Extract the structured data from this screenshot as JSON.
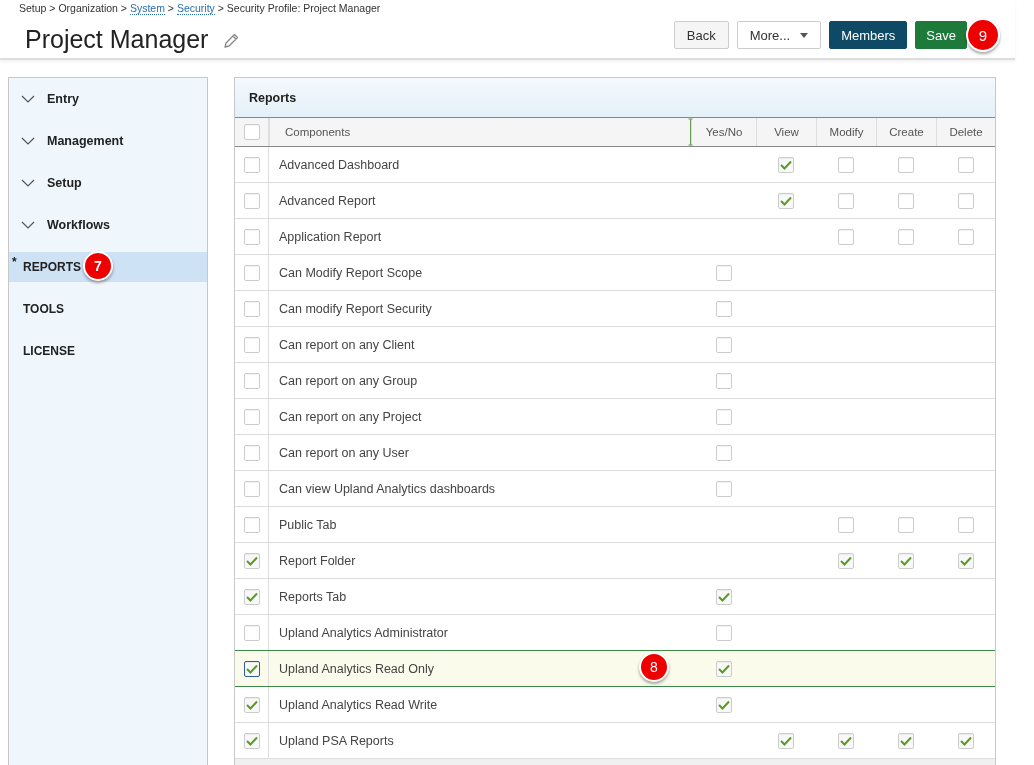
{
  "breadcrumb": [
    {
      "label": "Setup > Organization >",
      "link": false
    },
    {
      "label": "System",
      "link": true
    },
    {
      "label": ">",
      "link": false
    },
    {
      "label": "Security",
      "link": true
    },
    {
      "label": "> Security Profile: Project Manager",
      "link": false
    }
  ],
  "title": "Project Manager",
  "buttons": [
    {
      "label": "Back",
      "kind": "plain"
    },
    {
      "label": "More...",
      "kind": "dropdown"
    },
    {
      "label": "Members",
      "kind": "dark"
    },
    {
      "label": "Save",
      "kind": "primary",
      "badge": "9"
    }
  ],
  "sidebar": {
    "items": [
      {
        "label": "Entry",
        "kind": "group",
        "expanded": false,
        "selected": false
      },
      {
        "label": "Management",
        "kind": "group",
        "expanded": false,
        "selected": false
      },
      {
        "label": "Setup",
        "kind": "group",
        "expanded": false,
        "selected": false
      },
      {
        "label": "Workflows",
        "kind": "group",
        "expanded": false,
        "selected": false
      },
      {
        "label": "REPORTS",
        "kind": "section",
        "marker": "*",
        "selected": true,
        "badge": "7"
      },
      {
        "label": "TOOLS",
        "kind": "section",
        "selected": false
      },
      {
        "label": "LICENSE",
        "kind": "section",
        "selected": false
      }
    ]
  },
  "panel": {
    "title": "Reports",
    "columns": [
      "Components",
      "Yes/No",
      "View",
      "Modify",
      "Create",
      "Delete"
    ],
    "select_all": false,
    "rows": [
      {
        "name": "Advanced Dashboard",
        "checked": false,
        "selected": false,
        "view": true,
        "modify": false,
        "create": false,
        "delete": false
      },
      {
        "name": "Advanced Report",
        "checked": false,
        "selected": false,
        "view": true,
        "modify": false,
        "create": false,
        "delete": false
      },
      {
        "name": "Application Report",
        "checked": false,
        "selected": false,
        "modify": false,
        "create": false,
        "delete": false
      },
      {
        "name": "Can Modify Report Scope",
        "checked": false,
        "selected": false,
        "yes_no": false
      },
      {
        "name": "Can modify Report Security",
        "checked": false,
        "selected": false,
        "yes_no": false
      },
      {
        "name": "Can report on any Client",
        "checked": false,
        "selected": false,
        "yes_no": false
      },
      {
        "name": "Can report on any Group",
        "checked": false,
        "selected": false,
        "yes_no": false
      },
      {
        "name": "Can report on any Project",
        "checked": false,
        "selected": false,
        "yes_no": false
      },
      {
        "name": "Can report on any User",
        "checked": false,
        "selected": false,
        "yes_no": false
      },
      {
        "name": "Can view Upland Analytics dashboards",
        "checked": false,
        "selected": false,
        "yes_no": false
      },
      {
        "name": "Public Tab",
        "checked": false,
        "selected": false,
        "modify": false,
        "create": false,
        "delete": false
      },
      {
        "name": "Report Folder",
        "checked": true,
        "selected": false,
        "modify": true,
        "create": true,
        "delete": true
      },
      {
        "name": "Reports Tab",
        "checked": true,
        "selected": false,
        "yes_no": true
      },
      {
        "name": "Upland Analytics Administrator",
        "checked": false,
        "selected": false,
        "yes_no": false
      },
      {
        "name": "Upland Analytics Read Only",
        "checked": true,
        "selected": true,
        "yes_no": true,
        "badge": "8"
      },
      {
        "name": "Upland Analytics Read Write",
        "checked": true,
        "selected": false,
        "yes_no": true
      },
      {
        "name": "Upland PSA Reports",
        "checked": true,
        "selected": false,
        "view": true,
        "modify": true,
        "create": true,
        "delete": true
      }
    ]
  }
}
